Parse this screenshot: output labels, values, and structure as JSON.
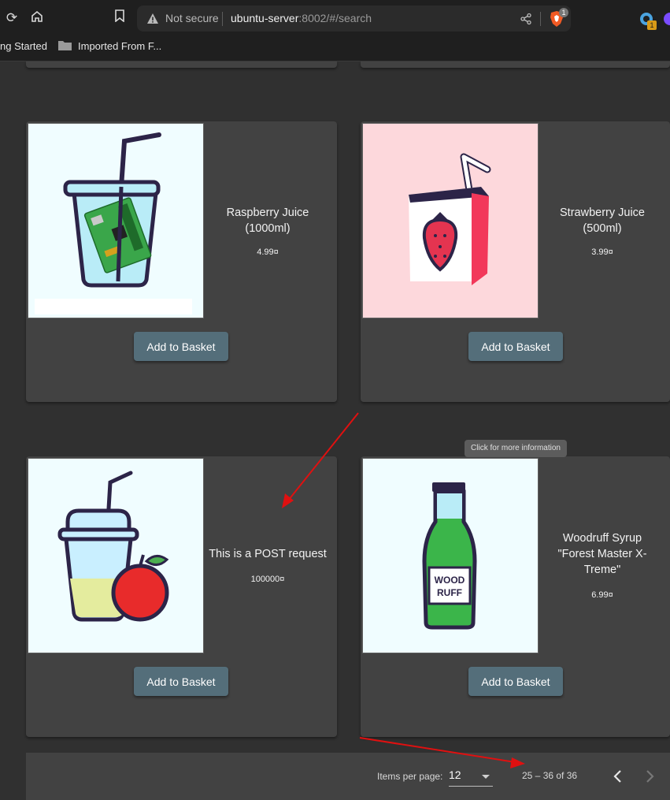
{
  "browser": {
    "url_warning": "Not secure",
    "url_host": "ubuntu-server",
    "url_rest": ":8002/#/search",
    "brave_badge": "1",
    "extension_badge": "1",
    "bookmarks": [
      "ng Started",
      "Imported From F..."
    ]
  },
  "products": [
    {
      "name": "Raspberry Juice (1000ml)",
      "price": "4.99¤",
      "button": "Add to Basket",
      "image_bg": "#f0fdff"
    },
    {
      "name": "Strawberry Juice (500ml)",
      "price": "3.99¤",
      "button": "Add to Basket",
      "image_bg": "#fdd8dc"
    },
    {
      "name": "This is a POST request",
      "price": "100000¤",
      "button": "Add to Basket",
      "image_bg": "#f0fdff"
    },
    {
      "name": "Woodruff Syrup \"Forest Master X-Treme\"",
      "price": "6.99¤",
      "button": "Add to Basket",
      "image_bg": "#f0fdff"
    }
  ],
  "woodruff_label": [
    "WOOD",
    "RUFF"
  ],
  "tooltip": "Click for more information",
  "paginator": {
    "items_per_page_label": "Items per page:",
    "items_per_page_value": "12",
    "range_label": "25 – 36 of 36"
  },
  "colors": {
    "page_bg": "#303030",
    "card_bg": "#424242",
    "button_bg": "#546e7a",
    "annotation_arrow": "#e01010"
  }
}
